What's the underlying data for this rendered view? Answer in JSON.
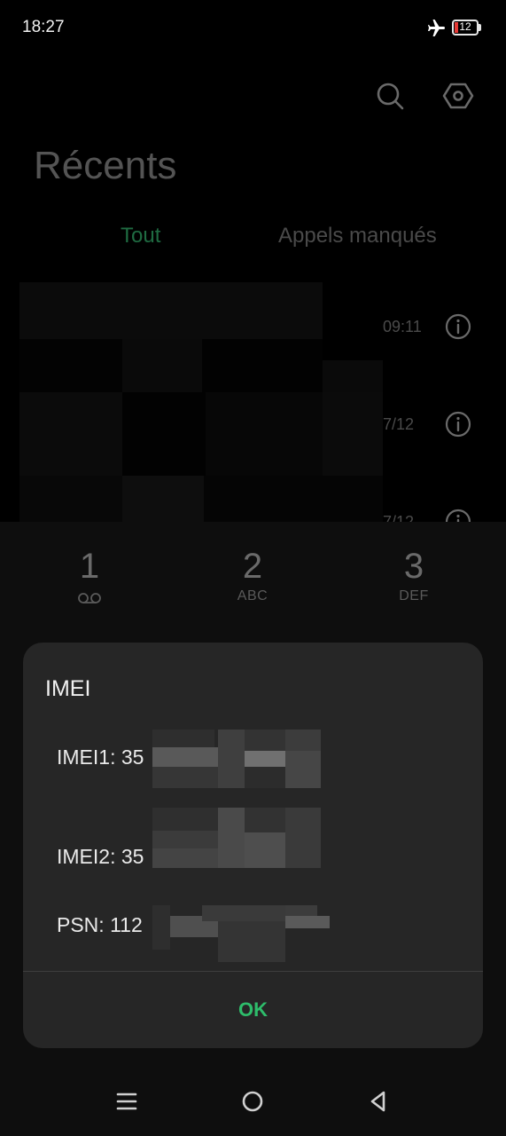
{
  "status": {
    "time": "18:27",
    "battery_level": "12"
  },
  "header": {
    "title": "Récents",
    "tabs": [
      {
        "label": "Tout"
      },
      {
        "label": "Appels manqués"
      }
    ]
  },
  "calls": [
    {
      "time": "09:11"
    },
    {
      "time": "7/12"
    },
    {
      "time": "7/12"
    }
  ],
  "dialpad": {
    "keys": [
      {
        "digit": "1",
        "sub": ""
      },
      {
        "digit": "2",
        "sub": "ABC"
      },
      {
        "digit": "3",
        "sub": "DEF"
      }
    ]
  },
  "dialog": {
    "title": "IMEI",
    "lines": [
      {
        "label": "IMEI1: 35"
      },
      {
        "label": "IMEI2: 35"
      },
      {
        "label": "PSN: 112"
      }
    ],
    "ok_label": "OK"
  },
  "colors": {
    "accent": "#2ebd6b",
    "battery_low": "#e53935"
  }
}
